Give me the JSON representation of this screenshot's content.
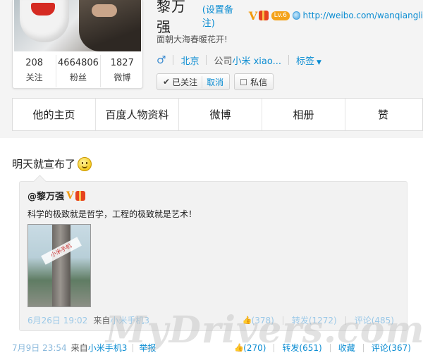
{
  "profile": {
    "name": "黎万强",
    "remark": "(设置备注)",
    "verified_badge": "V",
    "level_badge": "Lv.6",
    "url": "http://weibo.com/wanqiangli",
    "intro": "面朝大海春暖花开!",
    "gender_icon": "♂",
    "location": "北京",
    "company_prefix": "公司",
    "company_link": "小米 xiao...",
    "tags_label": "标签",
    "follow_status": "已关注",
    "cancel_label": "取消",
    "message_label": "私信",
    "stats": [
      {
        "num": "208",
        "label": "关注"
      },
      {
        "num": "4664806",
        "label": "粉丝"
      },
      {
        "num": "1827",
        "label": "微博"
      }
    ]
  },
  "tabs": [
    "他的主页",
    "百度人物资料",
    "微博",
    "相册",
    "赞"
  ],
  "post": {
    "text": "明天就宣布了",
    "emoji": "smile-icon",
    "repost": {
      "author": "@黎万强",
      "text": "科学的极致就是哲学，工程的极致就是艺术！",
      "photo_stamp": "小米手机",
      "time": "6月26日 19:02",
      "from_prefix": "来自",
      "device": "小米手机3",
      "likes": "(378)",
      "forward": "转发(1272)",
      "comment": "评论(485)"
    },
    "time": "7月9日 23:54",
    "from_prefix": "来自",
    "device": "小米手机3",
    "report": "举报",
    "likes": "(270)",
    "forward": "转发(651)",
    "favorite": "收藏",
    "comment": "评论(367)"
  },
  "watermark": "MyDrivers.com",
  "colors": {
    "link": "#0a8cd2",
    "v_badge": "#f29a0e"
  }
}
